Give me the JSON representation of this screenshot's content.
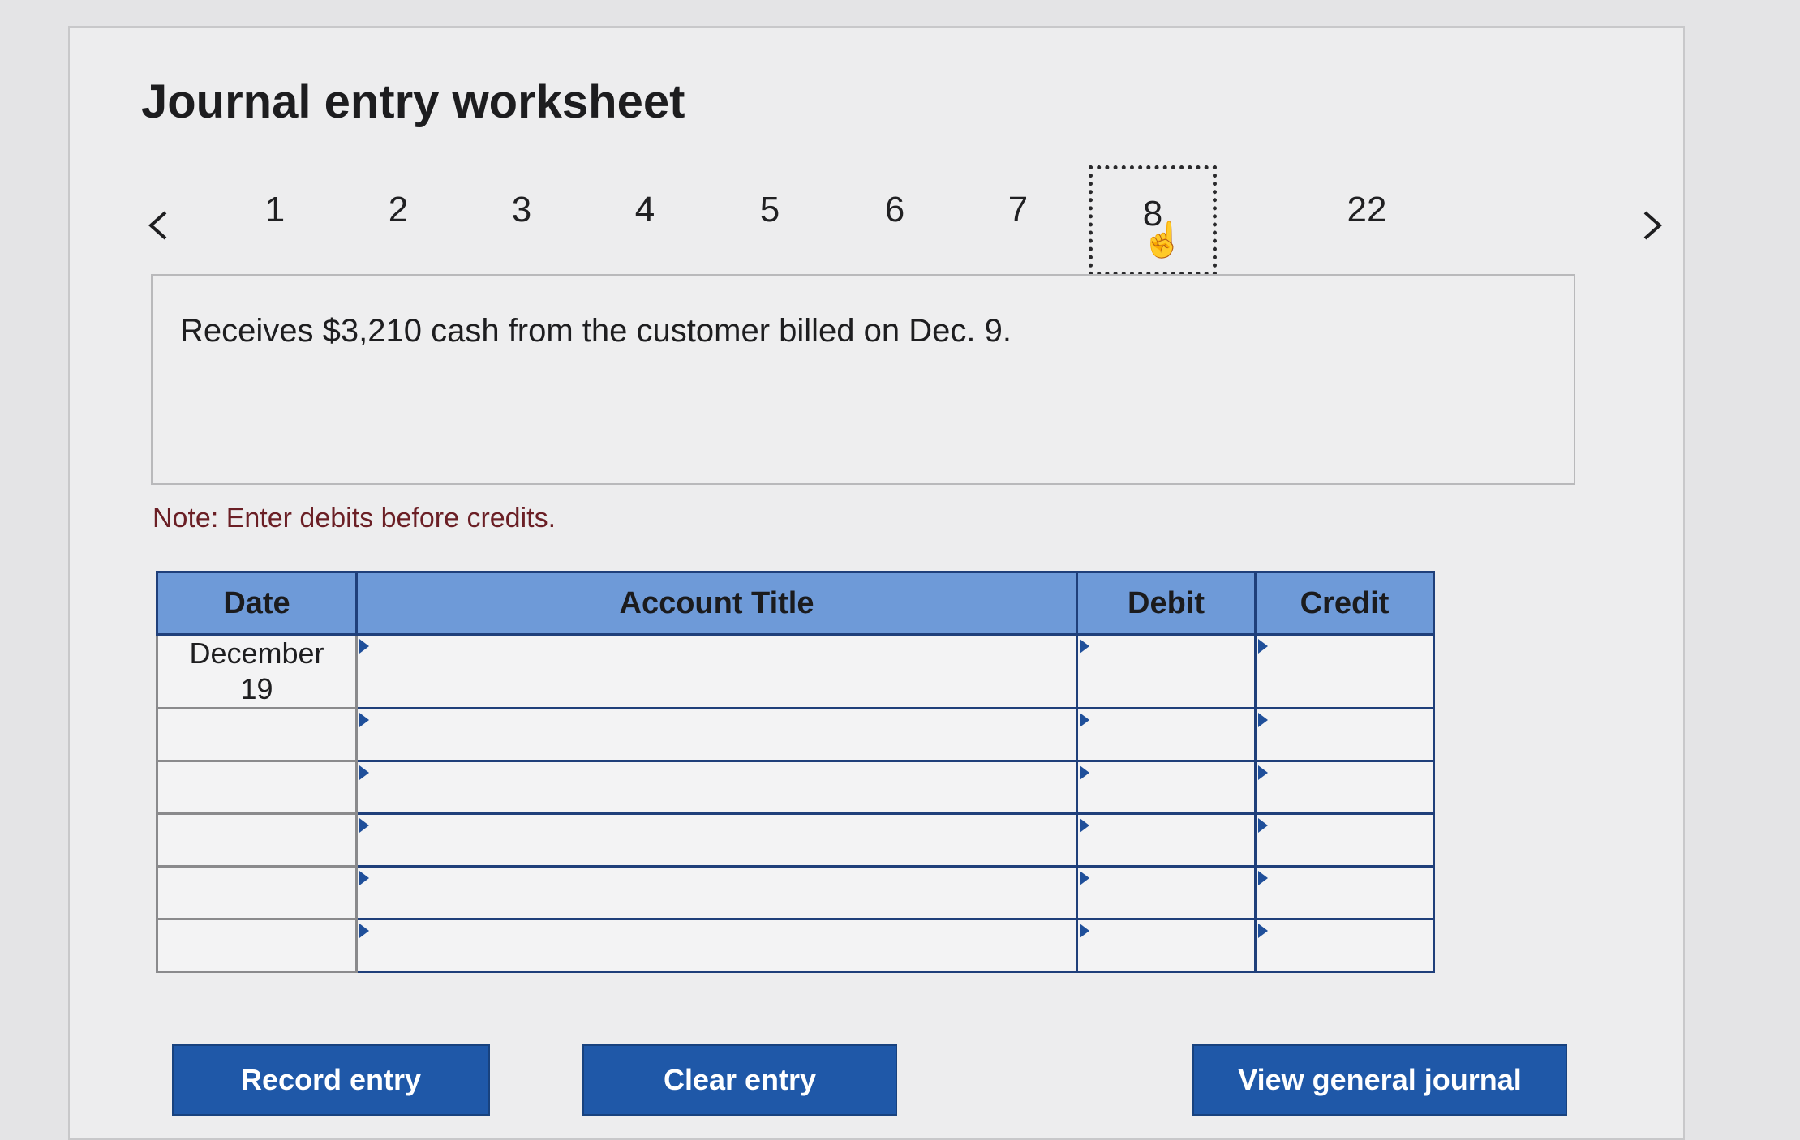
{
  "worksheet": {
    "title": "Journal entry worksheet",
    "tabs": [
      "1",
      "2",
      "3",
      "4",
      "5",
      "6",
      "7",
      "8",
      "22"
    ],
    "active_tab": "8",
    "description": "Receives $3,210 cash from the customer billed on Dec. 9.",
    "note": "Note: Enter debits before credits."
  },
  "table": {
    "headers": {
      "date": "Date",
      "account": "Account Title",
      "debit": "Debit",
      "credit": "Credit"
    },
    "date_line1": "December",
    "date_line2": "19"
  },
  "buttons": {
    "record": "Record entry",
    "clear": "Clear entry",
    "view": "View general journal"
  },
  "icons": {
    "prev": "chevron-left-icon",
    "next": "chevron-right-icon",
    "cursor": "hand-pointer-icon"
  },
  "colors": {
    "header_bg": "#6e9ad8",
    "button_bg": "#1f58a8",
    "note_text": "#6b1f25"
  }
}
